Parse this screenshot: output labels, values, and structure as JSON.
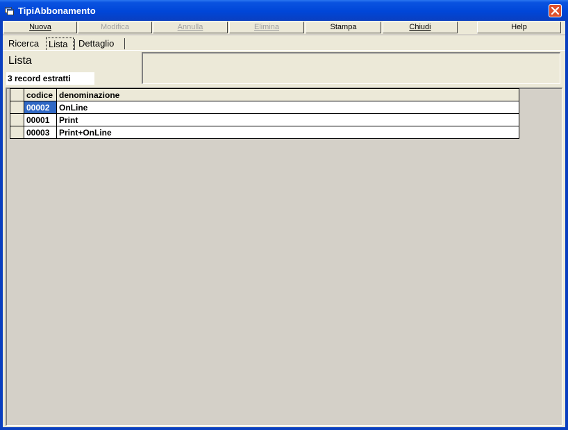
{
  "window": {
    "title": "TipiAbbonamento",
    "colors": {
      "titlebar": "#0046d8",
      "close": "#e0502a",
      "selection": "#3169c6"
    }
  },
  "toolbar": {
    "buttons": [
      {
        "label": "Nuova",
        "enabled": true
      },
      {
        "label": "Modifica",
        "enabled": false
      },
      {
        "label": "Annulla",
        "enabled": false
      },
      {
        "label": "Elimina",
        "enabled": false
      },
      {
        "label": "Stampa",
        "enabled": true
      },
      {
        "label": "Chiudi",
        "enabled": true
      },
      {
        "label": "Help",
        "enabled": true
      }
    ]
  },
  "tabs": [
    {
      "label": "Ricerca",
      "active": false
    },
    {
      "label": "Lista",
      "active": true
    },
    {
      "label": "Dettaglio",
      "active": false
    }
  ],
  "list": {
    "title": "Lista",
    "record_count": "3 record estratti",
    "columns": [
      "codice",
      "denominazione"
    ],
    "rows": [
      {
        "codice": "00002",
        "denominazione": "OnLine",
        "selected": true
      },
      {
        "codice": "00001",
        "denominazione": "Print",
        "selected": false
      },
      {
        "codice": "00003",
        "denominazione": "Print+OnLine",
        "selected": false
      }
    ]
  },
  "icons": {
    "app": "app-window-icon",
    "close": "close-icon"
  }
}
